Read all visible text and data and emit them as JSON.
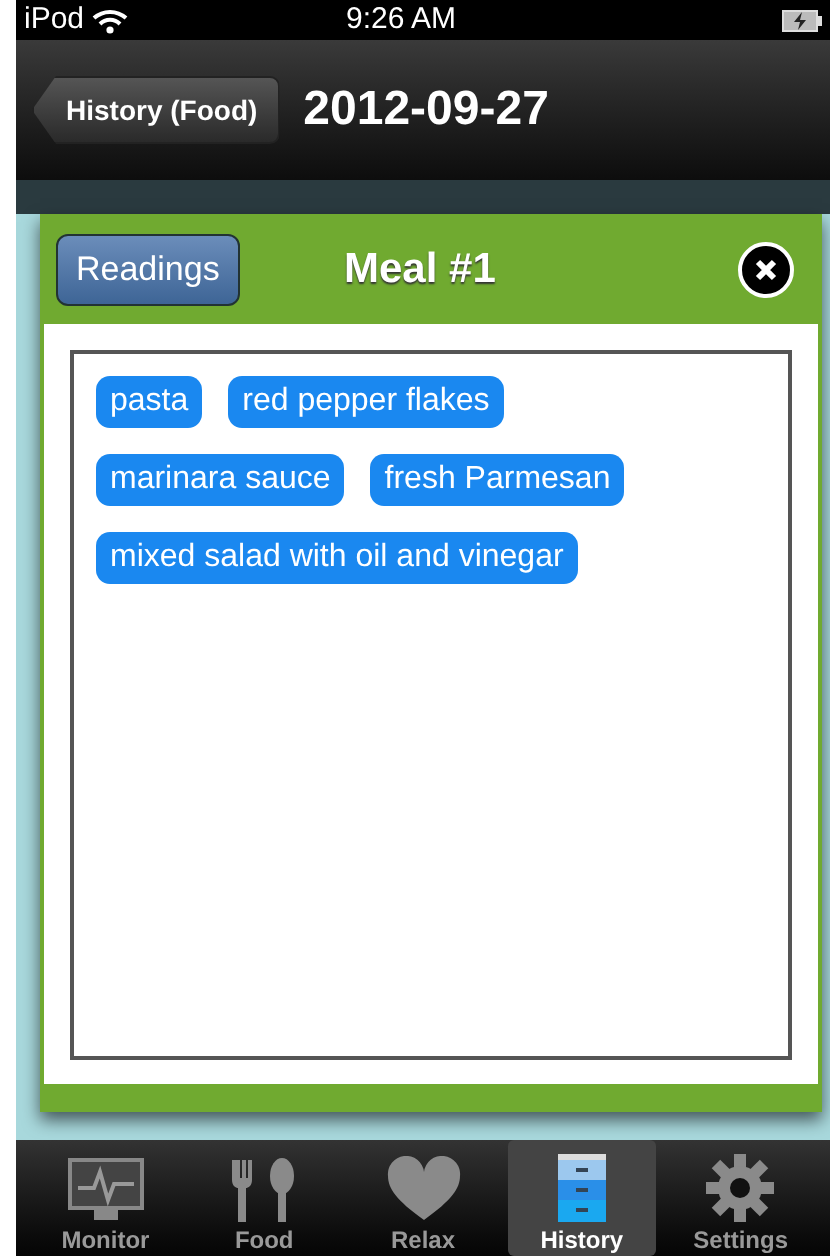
{
  "status_bar": {
    "carrier": "iPod",
    "time": "9:26 AM"
  },
  "nav_bar": {
    "back_button": "History (Food)",
    "title": "2012-09-27"
  },
  "modal": {
    "readings_button": "Readings",
    "title": "Meal #1",
    "tags": [
      "pasta",
      "red pepper flakes",
      "marinara sauce",
      "fresh Parmesan",
      "mixed salad with oil and vinegar"
    ]
  },
  "tab_bar": [
    {
      "label": "Monitor",
      "kind": "monitor",
      "selected": false
    },
    {
      "label": "Food",
      "kind": "food",
      "selected": false
    },
    {
      "label": "Relax",
      "kind": "relax",
      "selected": false
    },
    {
      "label": "History",
      "kind": "history",
      "selected": true
    },
    {
      "label": "Settings",
      "kind": "settings",
      "selected": false
    }
  ]
}
